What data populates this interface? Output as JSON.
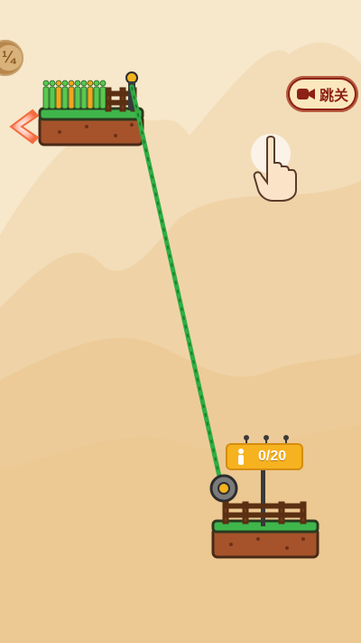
{
  "hud": {
    "skip_label": "跳关",
    "rescued_count": "0/20",
    "skip_icon": "video-camera-icon",
    "back_icon": "chevron-left-icon",
    "hint_icon": "hand-pointer-icon",
    "people_icon": "person-icon"
  },
  "colors": {
    "background": "#f7e7cb",
    "rope": "#2fae43",
    "grass": "#3fb64b",
    "dirt": "#a6532b",
    "sign": "#f6b21f",
    "skip_button": "#8c2118"
  }
}
